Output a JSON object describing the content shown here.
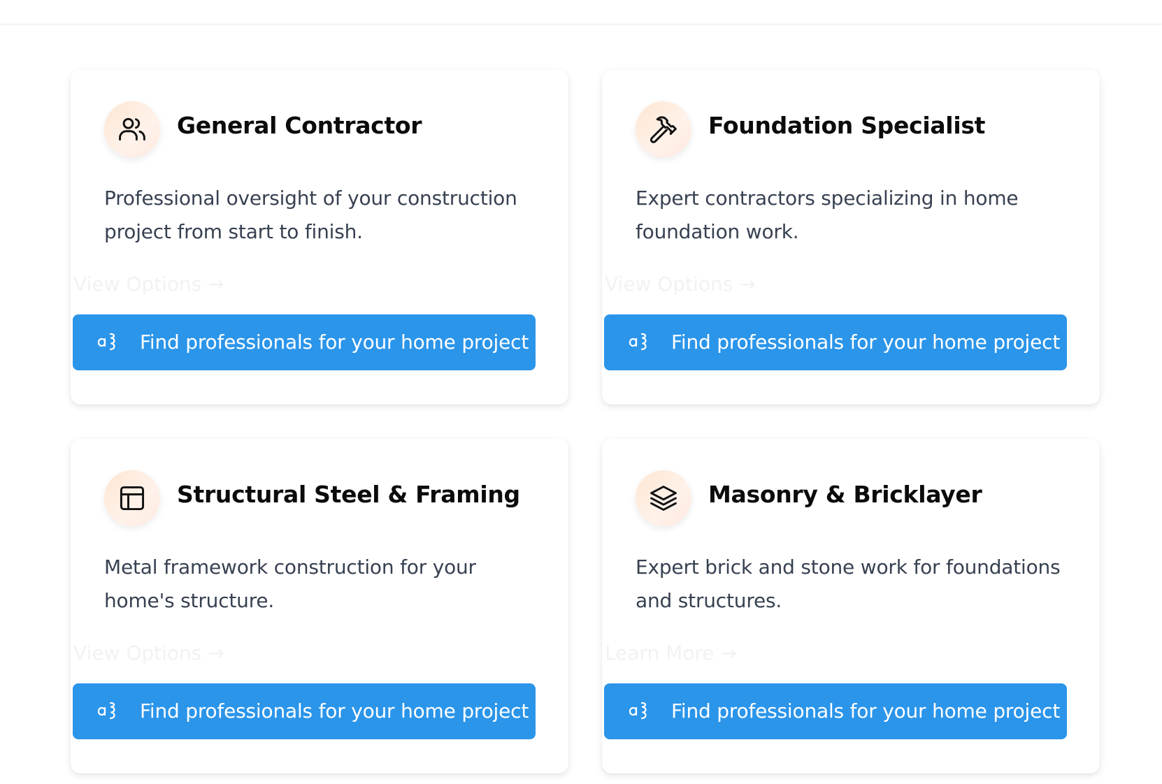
{
  "cards": [
    {
      "title": "General Contractor",
      "icon": "users-icon",
      "description": "Professional oversight of your construction project from start to finish.",
      "link_label": "View Options →",
      "cta_label": "Find professionals for your home project"
    },
    {
      "title": "Foundation Specialist",
      "icon": "hammer-icon",
      "description": "Expert contractors specializing in home foundation work.",
      "link_label": "View Options →",
      "cta_label": "Find professionals for your home project"
    },
    {
      "title": "Structural Steel & Framing",
      "icon": "layout-icon",
      "description": "Metal framework construction for your home's structure.",
      "link_label": "View Options →",
      "cta_label": "Find professionals for your home project"
    },
    {
      "title": "Masonry & Bricklayer",
      "icon": "layers-icon",
      "description": "Expert brick and stone work for foundations and structures.",
      "link_label": "Learn More →",
      "cta_label": "Find professionals for your home project"
    }
  ],
  "cta_icon": "translate-icon",
  "colors": {
    "cta_background": "#2b95ea",
    "title": "#0b0b0b",
    "description": "#374151",
    "icon_badge": "#fde6d2"
  }
}
